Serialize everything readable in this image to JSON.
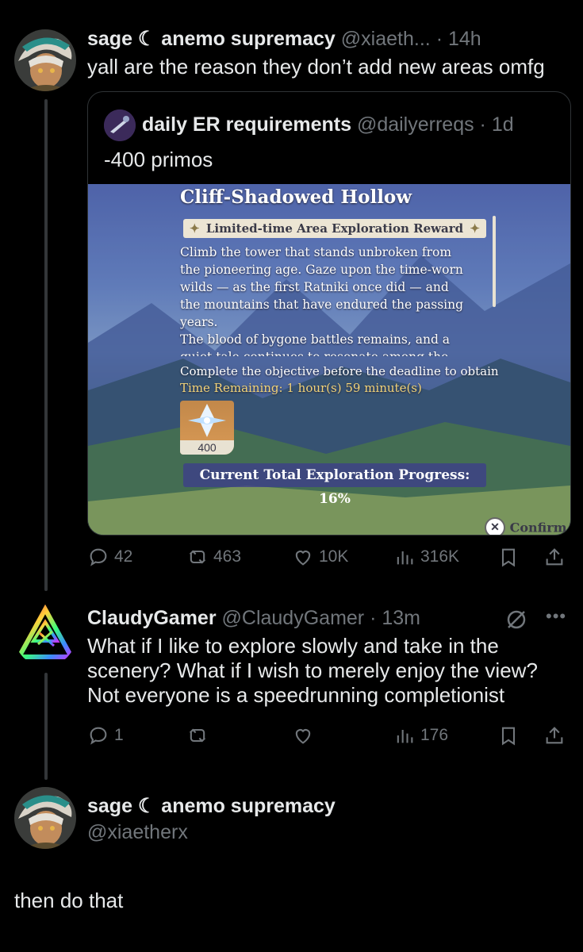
{
  "tweet1": {
    "display_name": "sage ☾ anemo supremacy",
    "handle": "@xiaeth...",
    "time": "14h",
    "text": "yall are the reason they don’t add new areas omfg",
    "quote": {
      "display_name": "daily ER requirements",
      "handle": "@dailyerreqs",
      "time": "1d",
      "text": "-400 primos",
      "game": {
        "area_title": "Cliff-Shadowed Hollow",
        "reward_label": "Limited-time Area Exploration Reward",
        "description_lines": [
          "Climb the tower that stands unbroken from",
          "the pioneering age. Gaze upon the time-worn",
          "wilds — as the first Ratniki once did — and",
          "the mountains that have endured the passing",
          "years.",
          "The blood of bygone battles remains, and a",
          "quiet tale continues to resonate among the"
        ],
        "objective": "Complete the objective before the deadline to obtain",
        "time_remaining": "Time Remaining: 1 hour(s) 59 minute(s)",
        "reward_count": "400",
        "progress_text": "Current Total Exploration Progress: 16%",
        "confirm_label": "Confirm"
      }
    },
    "stats": {
      "replies": "42",
      "reposts": "463",
      "likes": "10K",
      "views": "316K"
    }
  },
  "tweet2": {
    "display_name": "ClaudyGamer",
    "handle": "@ClaudyGamer",
    "time": "13m",
    "text_lines": [
      "What if I like to explore slowly and take in the",
      "scenery? What if I wish to merely enjoy the view?",
      "Not everyone is a speedrunning completionist"
    ],
    "stats": {
      "replies": "1",
      "views": "176"
    }
  },
  "tweet3": {
    "display_name": "sage ☾ anemo supremacy",
    "handle": "@xiaetherx",
    "text": "then do that"
  },
  "colors": {
    "background": "#000000",
    "text": "#e7e9ea",
    "muted": "#71767b",
    "border": "#2f3336"
  }
}
